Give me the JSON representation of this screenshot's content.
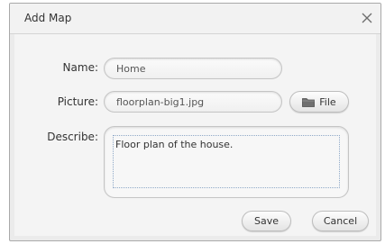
{
  "dialog": {
    "title": "Add Map",
    "close_icon": "close-icon"
  },
  "form": {
    "name_label": "Name:",
    "name_value": "Home",
    "picture_label": "Picture:",
    "picture_value": "floorplan-big1.jpg",
    "file_button_label": "File",
    "file_button_icon": "folder-icon",
    "describe_label": "Describe:",
    "describe_value": "Floor plan of the house."
  },
  "buttons": {
    "save_label": "Save",
    "cancel_label": "Cancel"
  }
}
